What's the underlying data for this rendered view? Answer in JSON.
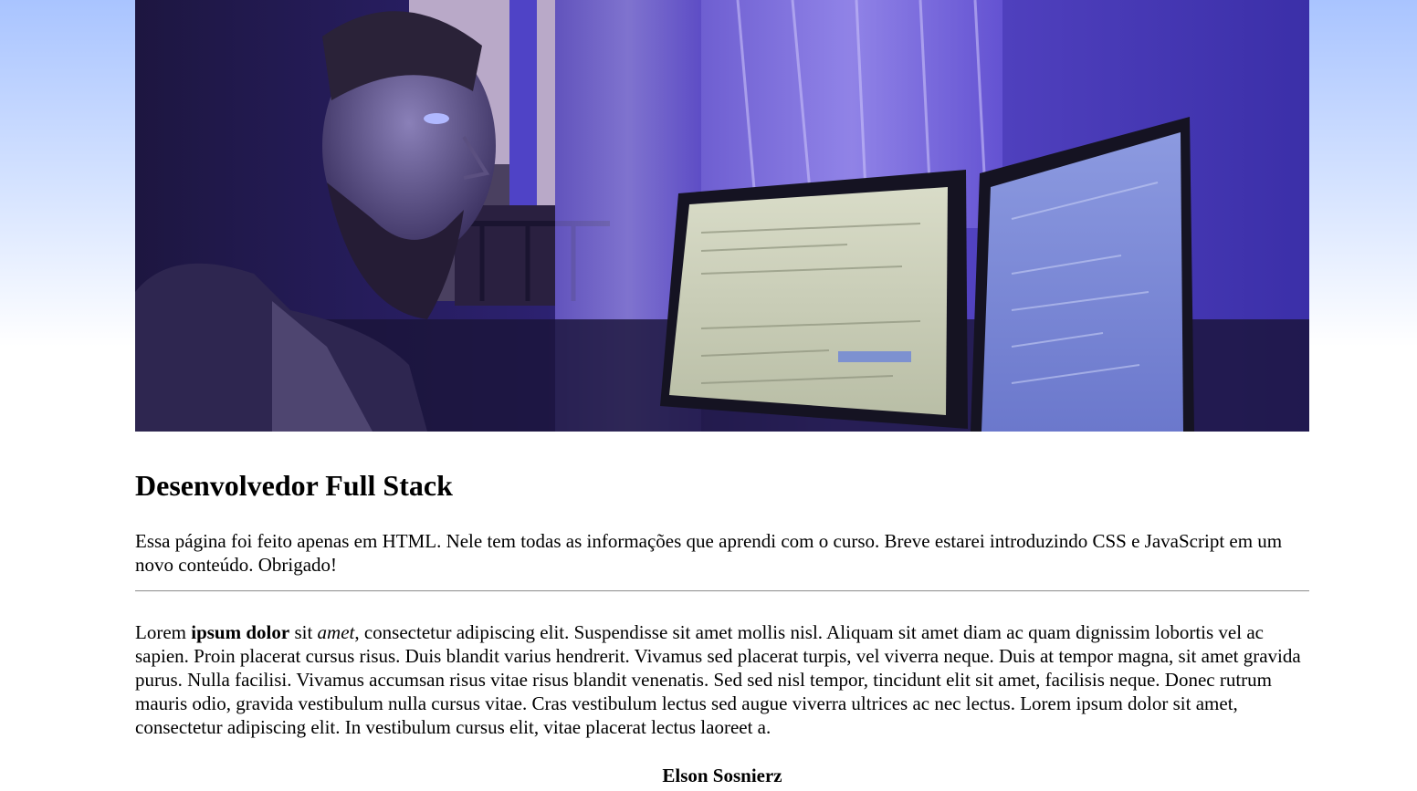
{
  "hero": {
    "alt": "Desenvolvedor em frente a dois monitores"
  },
  "header": {
    "title": "Desenvolvedor Full Stack"
  },
  "intro": {
    "text": "Essa página foi feito apenas em HTML. Nele tem todas as informações que aprendi com o curso. Breve estarei introduzindo CSS e JavaScript em um novo conteúdo. Obrigado!"
  },
  "article": {
    "word_lorem": "Lorem",
    "bold_text": "ipsum dolor",
    "word_sit": "sit",
    "italic_text": "amet",
    "rest": ", consectetur adipiscing elit. Suspendisse sit amet mollis nisl. Aliquam sit amet diam ac quam dignissim lobortis vel ac sapien. Proin placerat cursus risus. Duis blandit varius hendrerit. Vivamus sed placerat turpis, vel viverra neque. Duis at tempor magna, sit amet gravida purus. Nulla facilisi. Vivamus accumsan risus vitae risus blandit venenatis. Sed sed nisl tempor, tincidunt elit sit amet, facilisis neque. Donec rutrum mauris odio, gravida vestibulum nulla cursus vitae. Cras vestibulum lectus sed augue viverra ultrices ac nec lectus. Lorem ipsum dolor sit amet, consectetur adipiscing elit. In vestibulum cursus elit, vitae placerat lectus laoreet a."
  },
  "footer": {
    "author": "Elson Sosnierz"
  },
  "colors": {
    "background_top": "#a9c4ff",
    "hero_tint": "#3a2f8f"
  }
}
